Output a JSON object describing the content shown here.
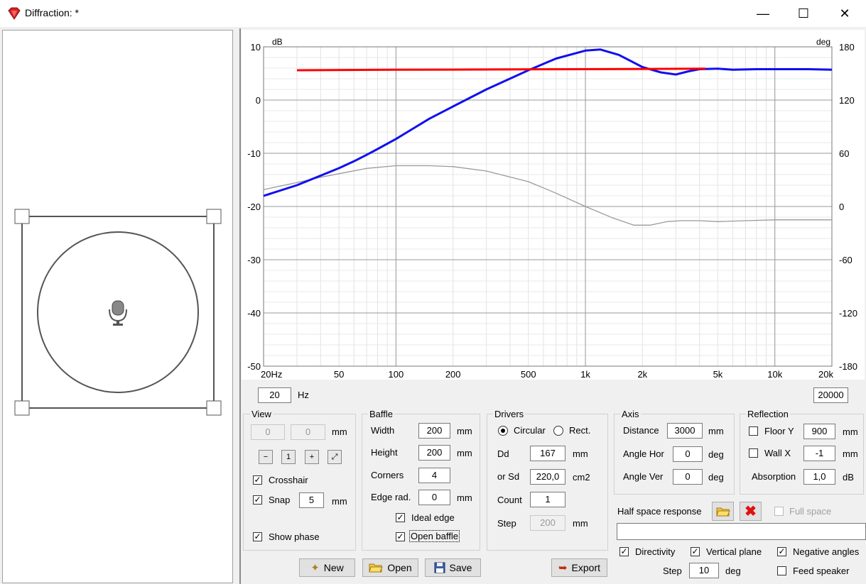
{
  "window": {
    "title": "Diffraction: *",
    "minimize": "—",
    "maximize": "☐",
    "close": "✕"
  },
  "chart_data": {
    "type": "line",
    "xscale": "log",
    "xlim": [
      20,
      20000
    ],
    "ylim": [
      -50,
      10
    ],
    "y2lim": [
      -180,
      180
    ],
    "ylabel": "dB",
    "y2label": "deg",
    "xticks": [
      {
        "v": 20,
        "t": "20Hz"
      },
      {
        "v": 50,
        "t": "50"
      },
      {
        "v": 100,
        "t": "100"
      },
      {
        "v": 200,
        "t": "200"
      },
      {
        "v": 500,
        "t": "500"
      },
      {
        "v": 1000,
        "t": "1k"
      },
      {
        "v": 2000,
        "t": "2k"
      },
      {
        "v": 5000,
        "t": "5k"
      },
      {
        "v": 10000,
        "t": "10k"
      },
      {
        "v": 20000,
        "t": "20k"
      }
    ],
    "yticks": [
      10,
      0,
      -10,
      -20,
      -30,
      -40,
      -50
    ],
    "y2ticks": [
      180,
      120,
      60,
      0,
      -60,
      -120,
      -180
    ],
    "grid": true,
    "series": [
      {
        "color": "#ff0000",
        "axis": "left",
        "x": [
          30,
          100,
          1000,
          4300
        ],
        "y": [
          5.6,
          5.7,
          5.8,
          5.9
        ]
      },
      {
        "color": "#1010ee",
        "axis": "left",
        "x": [
          20,
          30,
          40,
          50,
          60,
          70,
          80,
          100,
          120,
          150,
          200,
          300,
          500,
          700,
          1000,
          1200,
          1500,
          2000,
          2500,
          3000,
          3500,
          4000,
          5000,
          6000,
          8000,
          10000,
          15000,
          20000
        ],
        "y": [
          -18,
          -16,
          -14.2,
          -12.8,
          -11.5,
          -10.3,
          -9.2,
          -7.3,
          -5.6,
          -3.5,
          -1.2,
          2,
          5.6,
          7.8,
          9.3,
          9.5,
          8.5,
          6.2,
          5.2,
          4.8,
          5.4,
          5.8,
          5.9,
          5.7,
          5.8,
          5.8,
          5.8,
          5.7
        ]
      },
      {
        "color": "#9a9a9a",
        "axis": "right",
        "x": [
          20,
          30,
          40,
          50,
          70,
          100,
          150,
          200,
          300,
          500,
          700,
          1000,
          1400,
          1800,
          2200,
          2700,
          3200,
          4000,
          5000,
          7000,
          10000,
          20000
        ],
        "y": [
          19,
          27,
          33,
          37,
          43,
          46,
          46,
          45,
          40,
          28,
          15,
          0,
          -13,
          -21,
          -21,
          -17,
          -16,
          -16,
          -17,
          -16,
          -15,
          -15
        ]
      }
    ]
  },
  "freq": {
    "min": "20",
    "max": "20000",
    "unit": "Hz"
  },
  "view": {
    "title": "View",
    "x": "0",
    "y": "0",
    "unit": "mm",
    "crosshair": "Crosshair",
    "snap": "Snap",
    "snap_value": "5",
    "snap_unit": "mm",
    "show_phase": "Show phase"
  },
  "baffle": {
    "title": "Baffle",
    "width_label": "Width",
    "width": "200",
    "height_label": "Height",
    "height": "200",
    "corners_label": "Corners",
    "corners": "4",
    "edge_label": "Edge rad.",
    "edge": "0",
    "unit": "mm",
    "ideal_edge": "Ideal edge",
    "open_baffle": "Open baffle"
  },
  "drivers": {
    "title": "Drivers",
    "circular": "Circular",
    "rect": "Rect.",
    "dd_label": "Dd",
    "dd": "167",
    "dd_unit": "mm",
    "sd_label": "or Sd",
    "sd": "220,0",
    "sd_unit": "cm2",
    "count_label": "Count",
    "count": "1",
    "step_label": "Step",
    "step": "200",
    "step_unit": "mm"
  },
  "axis": {
    "title": "Axis",
    "distance_label": "Distance",
    "distance": "3000",
    "distance_unit": "mm",
    "hor_label": "Angle Hor",
    "hor": "0",
    "ver_label": "Angle Ver",
    "ver": "0",
    "deg": "deg"
  },
  "reflection": {
    "title": "Reflection",
    "floor_label": "Floor Y",
    "floor": "900",
    "wall_label": "Wall  X",
    "wall": "-1",
    "mm": "mm",
    "absorption_label": "Absorption",
    "absorption": "1,0",
    "db": "dB"
  },
  "half_space": {
    "label": "Half space response",
    "full_space": "Full space"
  },
  "options": {
    "directivity": "Directivity",
    "vertical_plane": "Vertical plane",
    "negative_angles": "Negative angles",
    "step_label": "Step",
    "step": "10",
    "step_unit": "deg",
    "feed_speaker": "Feed speaker"
  },
  "buttons": {
    "new": "New",
    "open": "Open",
    "save": "Save",
    "export": "Export"
  }
}
